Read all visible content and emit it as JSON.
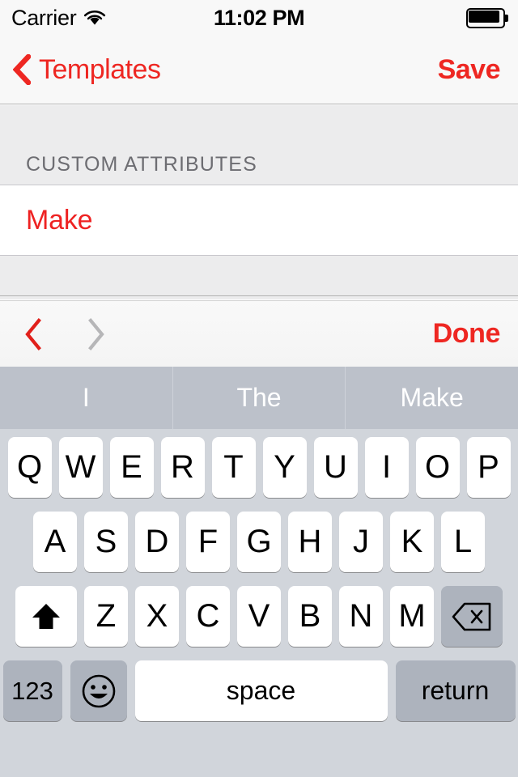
{
  "status_bar": {
    "carrier": "Carrier",
    "wifi_icon": "wifi-icon",
    "time": "11:02 PM",
    "battery_icon": "battery-full-icon"
  },
  "nav_bar": {
    "back_icon": "chevron-left-icon",
    "back_label": "Templates",
    "save_label": "Save"
  },
  "content": {
    "section_header": "CUSTOM ATTRIBUTES",
    "rows": [
      {
        "label": "Make"
      }
    ]
  },
  "keyboard_toolbar": {
    "prev_icon": "chevron-left-icon",
    "next_icon": "chevron-right-icon",
    "done_label": "Done"
  },
  "keyboard": {
    "predictions": [
      "I",
      "The",
      "Make"
    ],
    "row1": [
      "Q",
      "W",
      "E",
      "R",
      "T",
      "Y",
      "U",
      "I",
      "O",
      "P"
    ],
    "row2": [
      "A",
      "S",
      "D",
      "F",
      "G",
      "H",
      "J",
      "K",
      "L"
    ],
    "row3": [
      "Z",
      "X",
      "C",
      "V",
      "B",
      "N",
      "M"
    ],
    "shift_icon": "shift-arrow-icon",
    "delete_icon": "delete-backspace-icon",
    "numbers_label": "123",
    "emoji_icon": "smiley-face-icon",
    "space_label": "space",
    "return_label": "return"
  },
  "colors": {
    "accent_red": "#ee2722",
    "section_header_grey": "#6d6d72",
    "keyboard_bg": "#d1d5db",
    "predictive_bg": "#bcc1ca",
    "function_key": "#adb3bd"
  }
}
